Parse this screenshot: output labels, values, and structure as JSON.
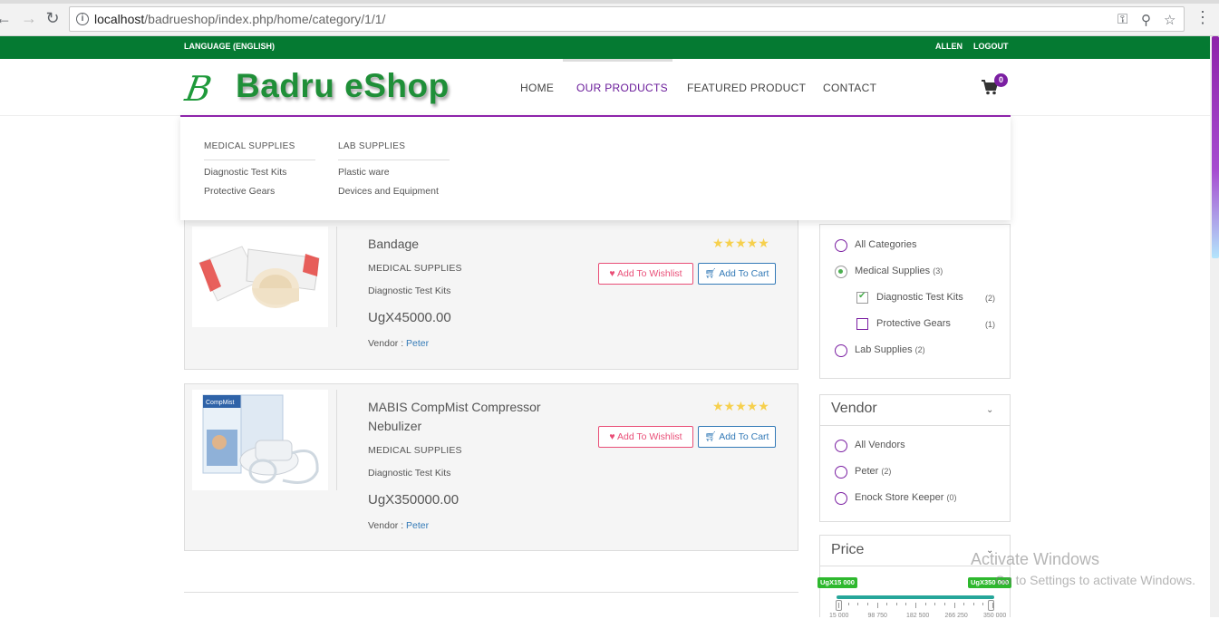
{
  "browser": {
    "url_host": "localhost",
    "url_path": "/badrueshop/index.php/home/category/1/1/"
  },
  "topbar": {
    "language": "LANGUAGE (ENGLISH)",
    "user": "ALLEN",
    "logout": "LOGOUT"
  },
  "brand": {
    "mark": "B",
    "name": "Badru eShop",
    "color": "#1f8f38"
  },
  "nav": {
    "home": "HOME",
    "products": "OUR PRODUCTS",
    "featured": "FEATURED PRODUCT",
    "contact": "CONTACT",
    "cart_count": "0"
  },
  "megamenu": {
    "col1": {
      "title": "MEDICAL SUPPLIES",
      "items": [
        "Diagnostic Test Kits",
        "Protective Gears"
      ]
    },
    "col2": {
      "title": "LAB SUPPLIES",
      "items": [
        "Plastic ware",
        "Devices and Equipment"
      ]
    }
  },
  "products": [
    {
      "name": "Bandage",
      "category": "MEDICAL SUPPLIES",
      "subcategory": "Diagnostic Test Kits",
      "price": "UgX45000.00",
      "vendor_label": "Vendor : ",
      "vendor": "Peter",
      "rating": 5,
      "wishlist": "Add To Wishlist",
      "cart": "Add To Cart"
    },
    {
      "name": "MABIS CompMist Compressor Nebulizer",
      "category": "MEDICAL SUPPLIES",
      "subcategory": "Diagnostic Test Kits",
      "price": "UgX350000.00",
      "vendor_label": "Vendor : ",
      "vendor": "Peter",
      "rating": 5,
      "wishlist": "Add To Wishlist",
      "cart": "Add To Cart"
    }
  ],
  "filters": {
    "categories": {
      "all": "All Categories",
      "medical": "Medical Supplies",
      "medical_count": "(3)",
      "diagnostic": "Diagnostic Test Kits",
      "diagnostic_count": "(2)",
      "protective": "Protective Gears",
      "protective_count": "(1)",
      "lab": "Lab Supplies",
      "lab_count": "(2)"
    },
    "vendor": {
      "title": "Vendor",
      "all": "All Vendors",
      "peter": "Peter",
      "peter_count": "(2)",
      "enock": "Enock Store Keeper",
      "enock_count": "(0)"
    },
    "price": {
      "title": "Price",
      "min_tag": "UgX15 000",
      "max_tag": "UgX350 000",
      "min_value": 15000,
      "max_value": 350000,
      "scale": [
        "15 000",
        "98 750",
        "182 500",
        "266 250",
        "350 000"
      ]
    }
  },
  "watermark": {
    "line1": "Activate Windows",
    "line2": "Go to Settings to activate Windows."
  }
}
